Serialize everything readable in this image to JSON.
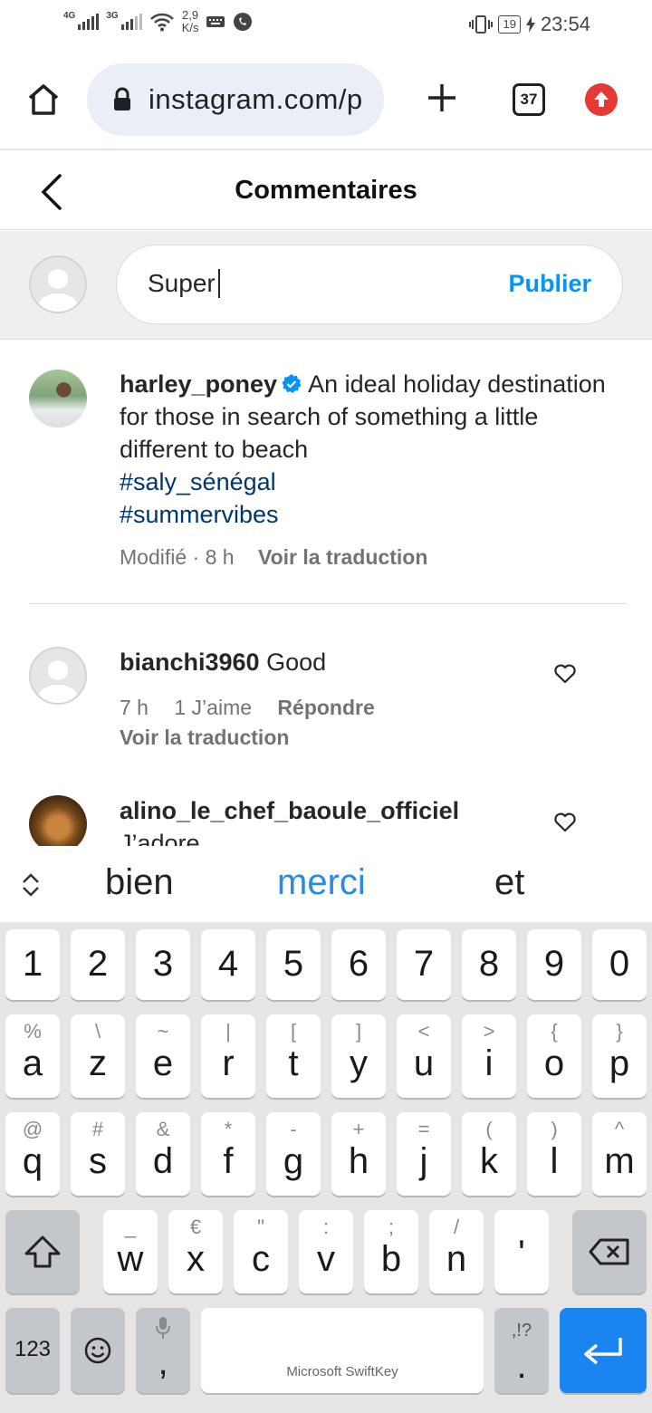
{
  "status_bar": {
    "network1": "4G",
    "network2": "3G",
    "speed_value": "2,9",
    "speed_unit": "K/s",
    "battery": "19",
    "time": "23:54"
  },
  "browser": {
    "url": "instagram.com/p",
    "tab_count": "37"
  },
  "header": {
    "title": "Commentaires"
  },
  "composer": {
    "value": "Super",
    "publish_label": "Publier"
  },
  "caption": {
    "username": "harley_poney",
    "text": "An ideal holiday destination for those in search of something a little different to beach",
    "hashtags": [
      "#saly_sénégal",
      "#summervibes"
    ],
    "meta": "Modifié · 8 h",
    "translate": "Voir la traduction"
  },
  "comments": [
    {
      "username": "bianchi3960",
      "text": "Good",
      "time": "7 h",
      "likes": "1 J’aime",
      "reply": "Répondre",
      "translate": "Voir la traduction"
    },
    {
      "username": "alino_le_chef_baoule_officiel",
      "text": "J’adore"
    }
  ],
  "suggestions": [
    "bien",
    "merci",
    "et"
  ],
  "keyboard": {
    "numbers": [
      "1",
      "2",
      "3",
      "4",
      "5",
      "6",
      "7",
      "8",
      "9",
      "0"
    ],
    "row1": [
      {
        "alt": "%",
        "key": "a"
      },
      {
        "alt": "\\",
        "key": "z"
      },
      {
        "alt": "~",
        "key": "e"
      },
      {
        "alt": "|",
        "key": "r"
      },
      {
        "alt": "[",
        "key": "t"
      },
      {
        "alt": "]",
        "key": "y"
      },
      {
        "alt": "<",
        "key": "u"
      },
      {
        "alt": ">",
        "key": "i"
      },
      {
        "alt": "{",
        "key": "o"
      },
      {
        "alt": "}",
        "key": "p"
      }
    ],
    "row2": [
      {
        "alt": "@",
        "key": "q"
      },
      {
        "alt": "#",
        "key": "s"
      },
      {
        "alt": "&",
        "key": "d"
      },
      {
        "alt": "*",
        "key": "f"
      },
      {
        "alt": "-",
        "key": "g"
      },
      {
        "alt": "+",
        "key": "h"
      },
      {
        "alt": "=",
        "key": "j"
      },
      {
        "alt": "(",
        "key": "k"
      },
      {
        "alt": ")",
        "key": "l"
      },
      {
        "alt": "^",
        "key": "m"
      }
    ],
    "row3": [
      {
        "alt": "_",
        "key": "w"
      },
      {
        "alt": "€",
        "key": "x"
      },
      {
        "alt": "\"",
        "key": "c"
      },
      {
        "alt": ":",
        "key": "v"
      },
      {
        "alt": ";",
        "key": "b"
      },
      {
        "alt": "/",
        "key": "n"
      },
      {
        "alt": "",
        "key": "'"
      }
    ],
    "numeric_label": "123",
    "comma": ",",
    "space_label": "Microsoft SwiftKey",
    "period_alt": ",!?",
    "period": "."
  },
  "colors": {
    "accent_blue": "#0095f6",
    "hashtag": "#00376b",
    "enter_key": "#1a84f0",
    "update_badge": "#e53935"
  }
}
